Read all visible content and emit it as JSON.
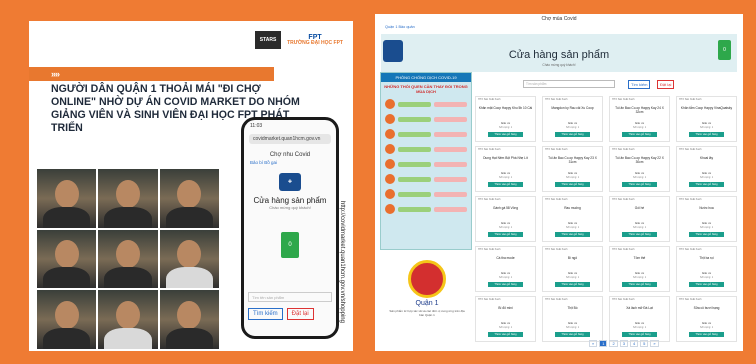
{
  "left_panel": {
    "logo1": "STARS",
    "logo2": "FPT",
    "logo2_sub": "TRƯỜNG ĐẠI HỌC FPT",
    "headline": "Người dân quận 1 thoải mái \"đi chợ online\" nhờ dự án Covid Market do nhóm giảng viên và sinh viên Đại học FPT phát triển",
    "vertical_url": "http://covidmarket.quan1hcm.gov.vn/shopping"
  },
  "phone": {
    "time": "11:03",
    "url": "covidmarket.quan1hcm.gov.vn",
    "site_name": "Chợ nhu Covid",
    "link": "Bảo bí  Bồ gai",
    "title": "Cửa hàng sản phẩm",
    "subtitle": "Chào mừng quý khách!",
    "cart_count": "0",
    "search_placeholder": "Tìm tên sản phẩm",
    "search_button": "Tìm kiếm",
    "order_button": "Đặt lại"
  },
  "right_panel": {
    "site_name": "Chợ mùa Covid",
    "links": "Quận 1  Bảo quản  ",
    "title": "Cửa hàng sản phẩm",
    "subtitle": "Chào mừng quý khách!",
    "cart_count": "0",
    "search_placeholder": "Tìm sản phẩm",
    "search_button": "Tìm kiếm",
    "order_button": "Đặt lại",
    "poster_title": "PHÒNG CHỐNG DỊCH COVID-19",
    "poster_subtitle": "NHỮNG THÓI QUEN CẦN THAY ĐỔI TRONG MÙA DỊCH",
    "district": "Quận 1",
    "district_note": "Sản phẩm từ hợp tác xã và các đơn vị cung ứng trên địa bàn Quận 1",
    "products": [
      {
        "shop": "HTX Sản Xuất Xanh",
        "name": "Khăn mặt Coop Happy Khu 5b 10 Cái",
        "price": "Giá: xx",
        "qty": "Số lượng: 1",
        "btn": "Thêm vào giỏ hàng"
      },
      {
        "shop": "HTX Sản Xuất Xanh",
        "name": "Mangdon ky Rau cải Xu Coop",
        "price": "Giá: xx",
        "qty": "Số lượng: 1",
        "btn": "Thêm vào giỏ hàng"
      },
      {
        "shop": "HTX Sản Xuất Xanh",
        "name": "Túi ăn Bao Co.op Happy Kay 24 X 32cm",
        "price": "Giá: xx",
        "qty": "Số lượng: 1",
        "btn": "Thêm vào giỏ hàng"
      },
      {
        "shop": "HTX Sản Xuất Xanh",
        "name": "Khăn tắm Coop Happy VinaQuatsky",
        "price": "Giá: xx",
        "qty": "Số lượng: 1",
        "btn": "Thêm vào giỏ hàng"
      },
      {
        "shop": "HTX Sản Xuất Xanh",
        "name": "Dung Hạt Nêm Bột Phá Nhẹ Lít",
        "price": "Giá: xx",
        "qty": "Số lượng: 1",
        "btn": "Thêm vào giỏ hàng"
      },
      {
        "shop": "HTX Sản Xuất Xanh",
        "name": "Túi ăn Bao Co.op Happy Kay 23 X 31cm",
        "price": "Giá: xx",
        "qty": "Số lượng: 1",
        "btn": "Thêm vào giỏ hàng"
      },
      {
        "shop": "HTX Sản Xuất Xanh",
        "name": "Túi ăn Bao Co.op Happy Kay 22 X 30cm",
        "price": "Giá: xx",
        "qty": "Số lượng: 1",
        "btn": "Thêm vào giỏ hàng"
      },
      {
        "shop": "HTX Sản Xuất Xanh",
        "name": "Khoai lây",
        "price": "Giá: xx",
        "qty": "Số lượng: 1",
        "btn": "Thêm vào giỏ hàng"
      },
      {
        "shop": "HTX Sản Xuất Xanh",
        "name": "Gánh gà 58 Vông",
        "price": "Giá: xx",
        "qty": "Số lượng: 1",
        "btn": "Thêm vào giỏ hàng"
      },
      {
        "shop": "HTX Sản Xuất Xanh",
        "name": "Rau muống",
        "price": "Giá: xx",
        "qty": "Số lượng: 1",
        "btn": "Thêm vào giỏ hàng"
      },
      {
        "shop": "HTX Sản Xuất Xanh",
        "name": "Gói hè",
        "price": "Giá: xx",
        "qty": "Số lượng: 1",
        "btn": "Thêm vào giỏ hàng"
      },
      {
        "shop": "HTX Sản Xuất Xanh",
        "name": "Nước hoa",
        "price": "Giá: xx",
        "qty": "Số lượng: 1",
        "btn": "Thêm vào giỏ hàng"
      },
      {
        "shop": "HTX Sản Xuất Xanh",
        "name": "Cá tha mode",
        "price": "Giá: xx",
        "qty": "Số lượng: 1",
        "btn": "Thêm vào giỏ hàng"
      },
      {
        "shop": "HTX Sản Xuất Xanh",
        "name": "Bí ngô",
        "price": "Giá: xx",
        "qty": "Số lượng: 1",
        "btn": "Thêm vào giỏ hàng"
      },
      {
        "shop": "HTX Sản Xuất Xanh",
        "name": "Tôm thẻ",
        "price": "Giá: xx",
        "qty": "Số lượng: 1",
        "btn": "Thêm vào giỏ hàng"
      },
      {
        "shop": "HTX Sản Xuất Xanh",
        "name": "Thịt ba rọi",
        "price": "Giá: xx",
        "qty": "Số lượng: 1",
        "btn": "Thêm vào giỏ hàng"
      },
      {
        "shop": "HTX Sản Xuất Xanh",
        "name": "Bí đỏ mini",
        "price": "Giá: xx",
        "qty": "Số lượng: 1",
        "btn": "Thêm vào giỏ hàng"
      },
      {
        "shop": "HTX Sản Xuất Xanh",
        "name": "Thịt Bò",
        "price": "Giá: xx",
        "qty": "Số lượng: 1",
        "btn": "Thêm vào giỏ hàng"
      },
      {
        "shop": "HTX Sản Xuất Xanh",
        "name": "Xà lách mỡ Đà Lạt",
        "price": "Giá: xx",
        "qty": "Số lượng: 1",
        "btn": "Thêm vào giỏ hàng"
      },
      {
        "shop": "HTX Sản Xuất Xanh",
        "name": "Sữa cô bươi hạng",
        "price": "Giá: xx",
        "qty": "Số lượng: 1",
        "btn": "Thêm vào giỏ hàng"
      }
    ],
    "pager": [
      "«",
      "1",
      "2",
      "3",
      "4",
      "5",
      "»"
    ]
  }
}
